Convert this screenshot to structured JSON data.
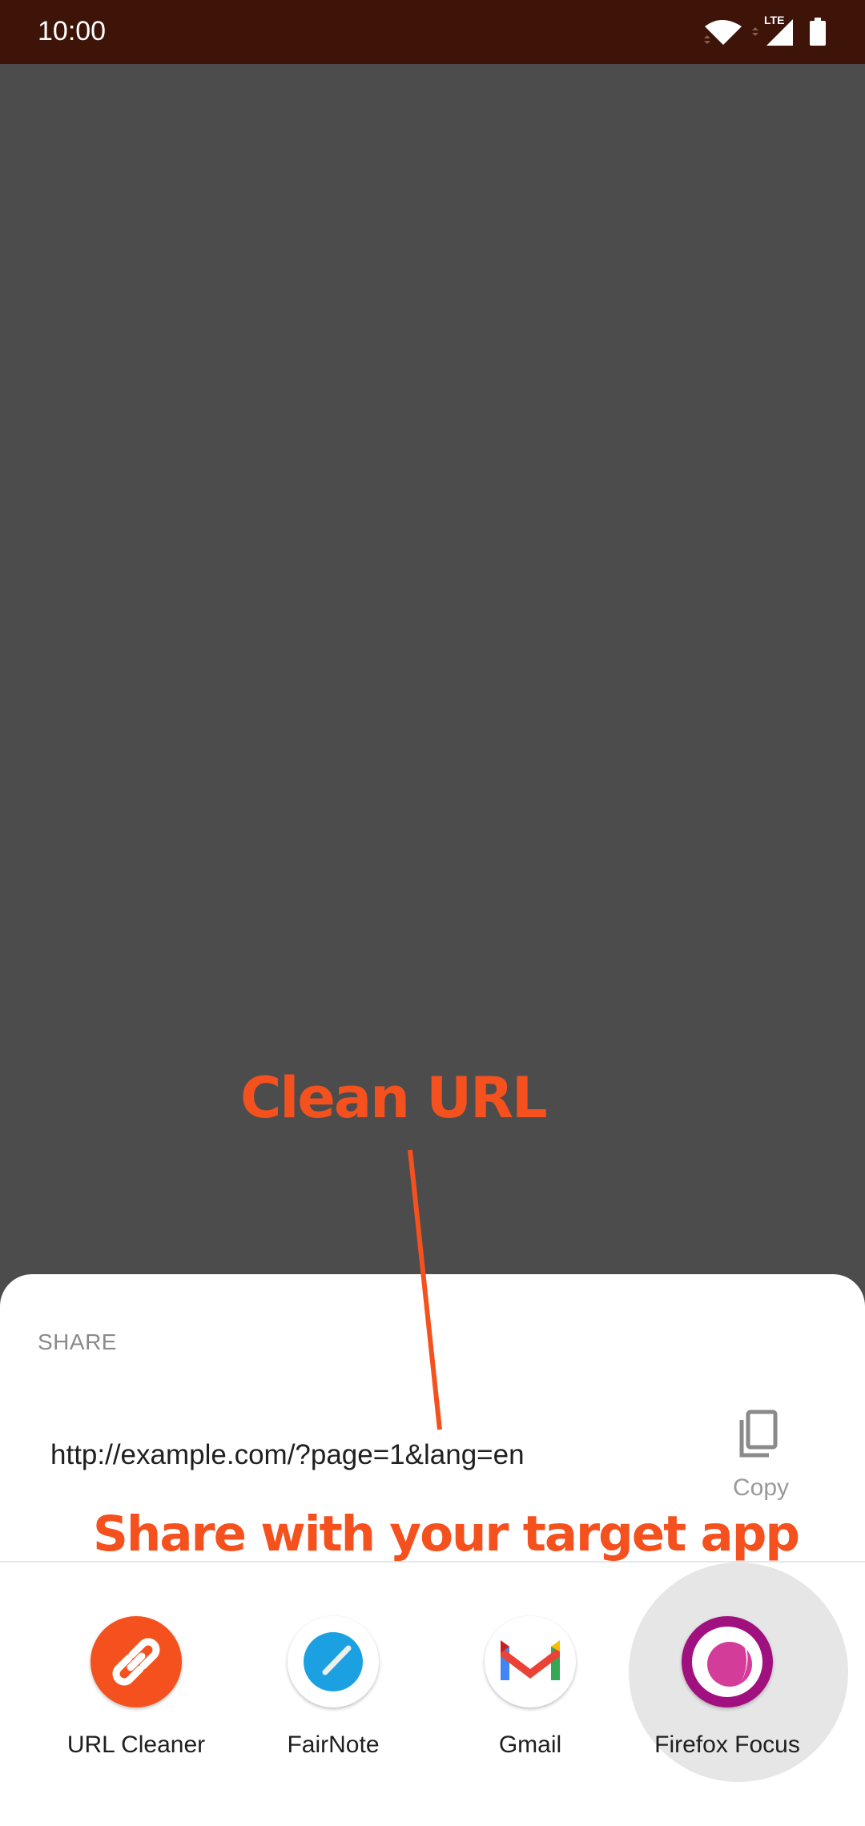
{
  "status_bar": {
    "time": "10:00",
    "network": "LTE"
  },
  "share_sheet": {
    "title": "SHARE",
    "shared_text": "http://example.com/?page=1&lang=en",
    "copy_label": "Copy",
    "apps": [
      {
        "label": "URL Cleaner",
        "icon": "link-icon",
        "color": "#f4511e"
      },
      {
        "label": "FairNote",
        "icon": "pen-icon",
        "color": "#1ba1e2"
      },
      {
        "label": "Gmail",
        "icon": "gmail-icon",
        "color": "#ea4335"
      },
      {
        "label": "Firefox Focus",
        "icon": "firefox-focus-icon",
        "color": "#a0107f"
      }
    ]
  },
  "annotations": {
    "top": "Clean URL",
    "bottom": "Share with your target app",
    "color": "#f4511e"
  }
}
